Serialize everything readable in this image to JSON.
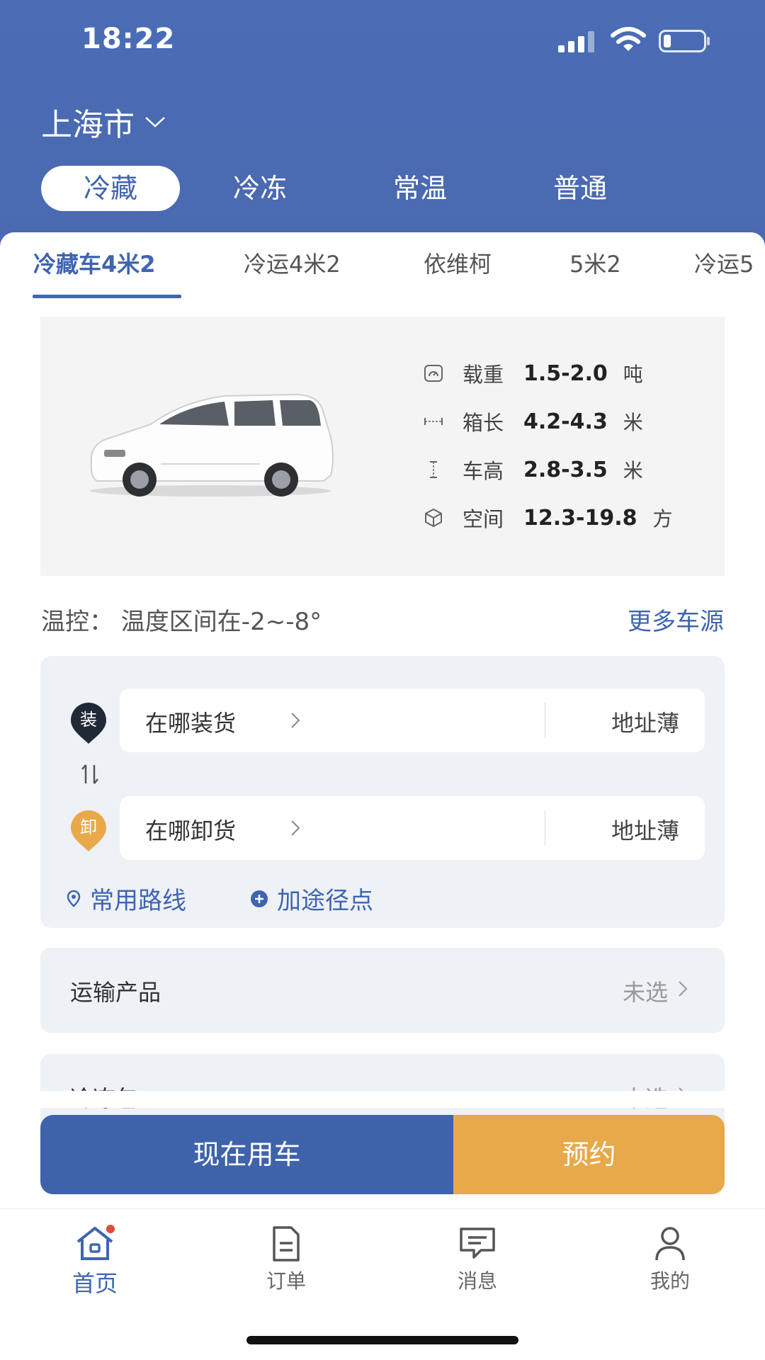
{
  "status_bar": {
    "time": "18:22"
  },
  "header": {
    "city": "上海市",
    "categories": [
      {
        "label": "冷藏",
        "active": true
      },
      {
        "label": "冷冻",
        "active": false
      },
      {
        "label": "常温",
        "active": false
      },
      {
        "label": "普通",
        "active": false
      }
    ]
  },
  "vehicle_tabs": [
    {
      "label": "冷藏车4米2",
      "active": true
    },
    {
      "label": "冷运4米2",
      "active": false
    },
    {
      "label": "依维柯",
      "active": false
    },
    {
      "label": "5米2",
      "active": false
    },
    {
      "label": "冷运5",
      "active": false
    }
  ],
  "vehicle": {
    "specs": [
      {
        "icon": "gauge-icon",
        "label": "载重",
        "value": "1.5-2.0",
        "unit": "吨"
      },
      {
        "icon": "length-icon",
        "label": "箱长",
        "value": "4.2-4.3",
        "unit": "米"
      },
      {
        "icon": "height-icon",
        "label": "车高",
        "value": "2.8-3.5",
        "unit": "米"
      },
      {
        "icon": "cube-icon",
        "label": "空间",
        "value": "12.3-19.8",
        "unit": "方"
      }
    ]
  },
  "temperature": {
    "text": "温控：  温度区间在-2~-8°",
    "more_link": "更多车源"
  },
  "route": {
    "load": {
      "badge": "装",
      "placeholder": "在哪装货",
      "address_book": "地址薄"
    },
    "unload": {
      "badge": "卸",
      "placeholder": "在哪卸货",
      "address_book": "地址薄"
    },
    "common_routes": "常用路线",
    "add_stop": "加途径点"
  },
  "options": [
    {
      "label": "运输产品",
      "value": "未选"
    },
    {
      "label": "冷冻包",
      "value": "未选"
    }
  ],
  "cta": {
    "now": "现在用车",
    "book": "预约"
  },
  "tabbar": [
    {
      "label": "首页",
      "icon": "home-icon",
      "active": true
    },
    {
      "label": "订单",
      "icon": "document-icon",
      "active": false
    },
    {
      "label": "消息",
      "icon": "message-icon",
      "active": false
    },
    {
      "label": "我的",
      "icon": "person-icon",
      "active": false
    }
  ],
  "colors": {
    "primary": "#3f63ab",
    "accent": "#e8a94a",
    "header": "#4a6db5"
  }
}
